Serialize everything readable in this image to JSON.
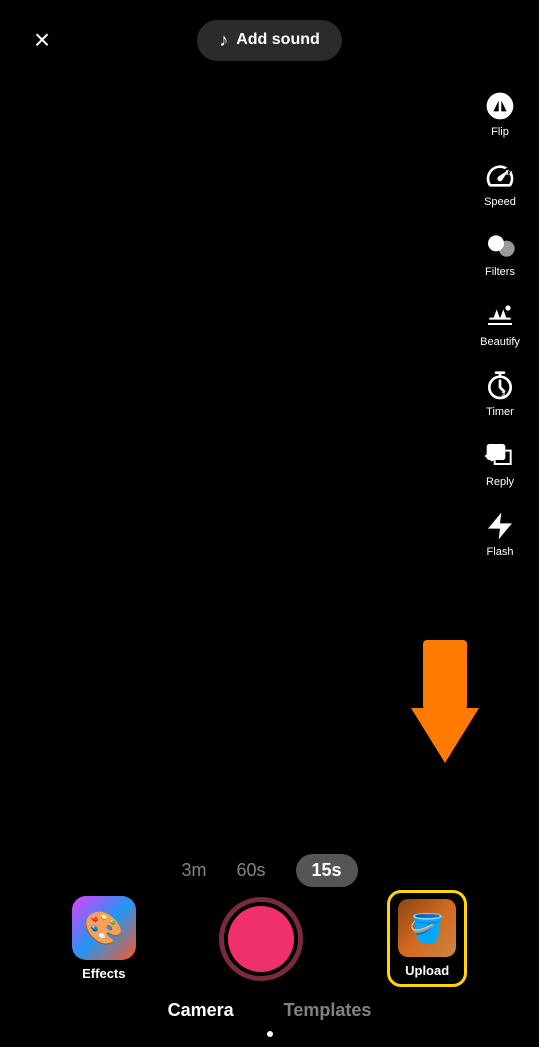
{
  "top": {
    "close_label": "×",
    "add_sound_label": "Add sound",
    "music_icon": "♪"
  },
  "sidebar": {
    "items": [
      {
        "id": "flip",
        "label": "Flip"
      },
      {
        "id": "speed",
        "label": "Speed"
      },
      {
        "id": "filters",
        "label": "Filters"
      },
      {
        "id": "beautify",
        "label": "Beautify"
      },
      {
        "id": "timer",
        "label": "Timer"
      },
      {
        "id": "reply",
        "label": "Reply"
      },
      {
        "id": "flash",
        "label": "Flash"
      }
    ]
  },
  "duration": {
    "items": [
      {
        "id": "3m",
        "label": "3m",
        "active": false
      },
      {
        "id": "60s",
        "label": "60s",
        "active": false
      },
      {
        "id": "15s",
        "label": "15s",
        "active": true
      }
    ]
  },
  "bottom": {
    "effects_label": "Effects",
    "upload_label": "Upload",
    "upload_icon": "🪣"
  },
  "nav": {
    "tabs": [
      {
        "id": "camera",
        "label": "Camera",
        "active": true
      },
      {
        "id": "templates",
        "label": "Templates",
        "active": false
      }
    ]
  }
}
